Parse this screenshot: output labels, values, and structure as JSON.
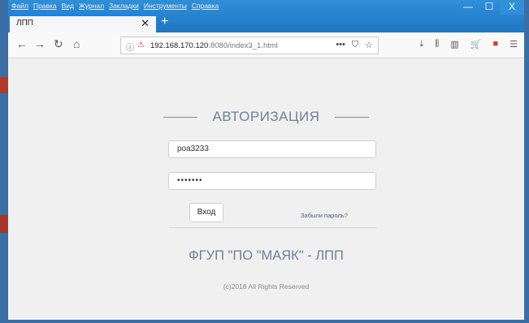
{
  "browser": {
    "menu": [
      "Файл",
      "Правка",
      "Вид",
      "Журнал",
      "Закладки",
      "Инструменты",
      "Справка"
    ],
    "tab_title": "ЛПП",
    "tab_close": "✕",
    "new_tab": "+",
    "window_buttons": {
      "minimize": "—",
      "maximize": "☐",
      "close": "X"
    },
    "nav": {
      "back": "←",
      "forward": "→",
      "reload": "↻",
      "home": "⌂"
    },
    "url": {
      "host": "192.168.170.120",
      "rest": ":8080/index3_1.html"
    },
    "url_icons": {
      "info": "ⓘ",
      "lock": "⚠",
      "more": "•••",
      "pocket": "⛉",
      "bookmark": "☆"
    },
    "toolbar": {
      "download": "⤓",
      "library": "⫼",
      "sidebar": "▥",
      "cart": "🛒",
      "flag": "■",
      "menu": "☰"
    }
  },
  "page": {
    "heading": "АВТОРИЗАЦИЯ",
    "login_value": "poa3233",
    "password_value": "•••••••",
    "submit_label": "Вход",
    "forgot_link": "Забыли пароль?",
    "org_name": "ФГУП \"ПО \"МАЯК\" - ЛПП",
    "copyright": "(c)2018 All Rights Reserved"
  },
  "colors": {
    "accent": "#6f8197",
    "titlebar": "#1f76c3",
    "background": "#f0f0f0"
  }
}
